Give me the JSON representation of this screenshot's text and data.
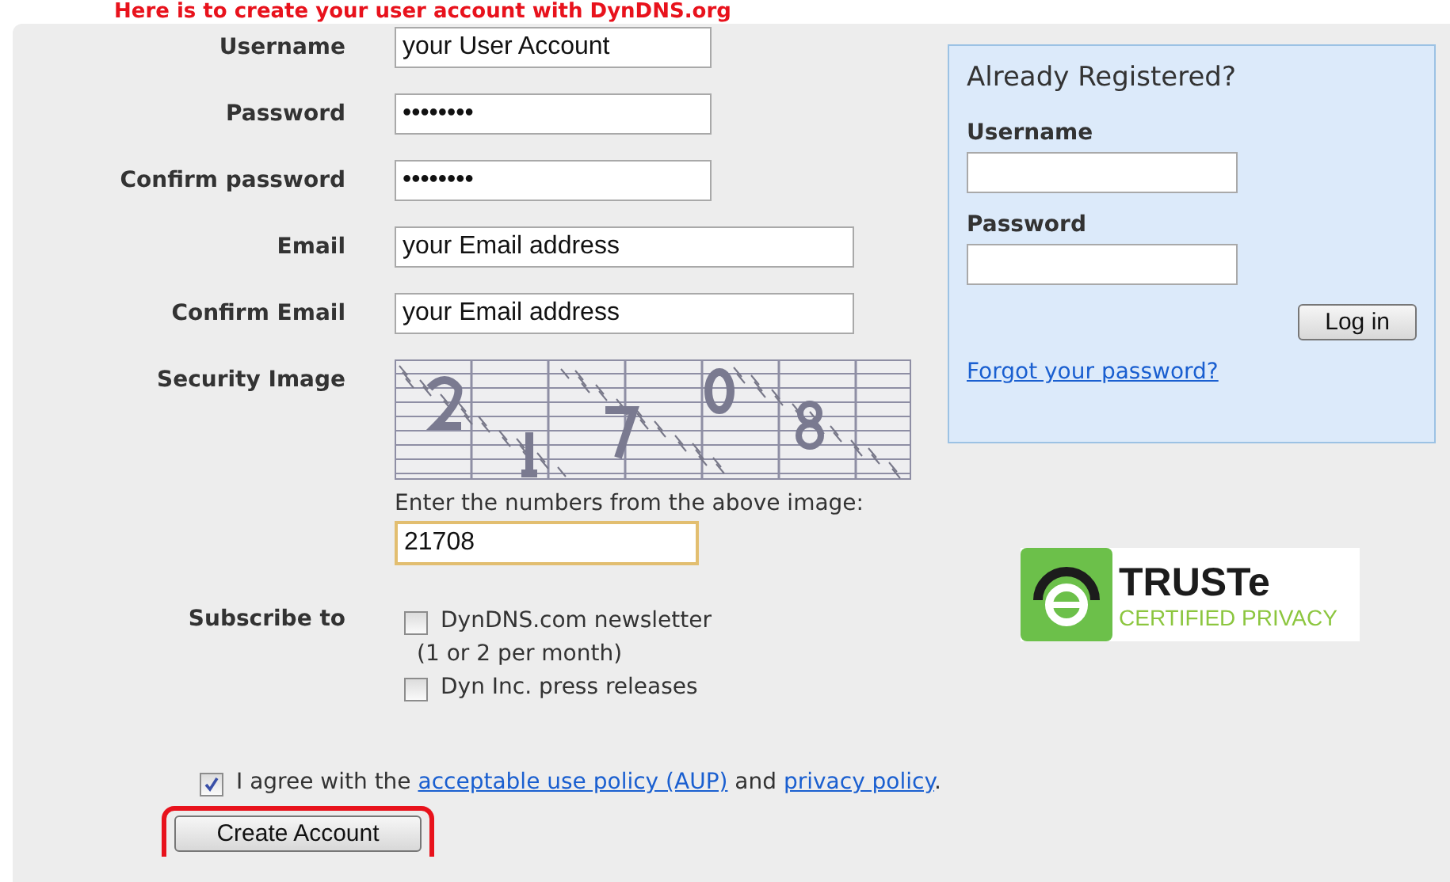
{
  "heading": "Here is to create your user account with DynDNS.org",
  "fields": [
    {
      "label": "Username",
      "value": "your User Account",
      "kind": "text"
    },
    {
      "label": "Password",
      "value": "••••••••",
      "kind": "password"
    },
    {
      "label": "Confirm password",
      "value": "••••••••",
      "kind": "password"
    },
    {
      "label": "Email",
      "value": "your Email address",
      "kind": "email"
    },
    {
      "label": "Confirm Email",
      "value": "your Email address",
      "kind": "email"
    }
  ],
  "security": {
    "label": "Security Image",
    "hint": "Enter the numbers from the above image:",
    "value": "21708",
    "focused": true
  },
  "subscribe": {
    "label": "Subscribe to",
    "options": [
      {
        "label": "DynDNS.com newsletter",
        "note": "(1 or 2 per month)",
        "checked": false
      },
      {
        "label": "Dyn Inc. press releases",
        "checked": false
      }
    ]
  },
  "agree": {
    "checked": true,
    "parts": [
      {
        "kind": "text",
        "text": "I agree with the "
      },
      {
        "kind": "link",
        "text": "acceptable use policy (AUP)"
      },
      {
        "kind": "text",
        "text": " and "
      },
      {
        "kind": "link",
        "text": "privacy policy"
      },
      {
        "kind": "text",
        "text": "."
      }
    ]
  },
  "create": {
    "label": "Create Account",
    "highlighted": true
  },
  "login": {
    "title": "Already Registered?",
    "fields": [
      {
        "label": "Username"
      },
      {
        "label": "Password"
      }
    ],
    "button": "Log in",
    "link": "Forgot your password?"
  },
  "badge": {
    "name": "TRUSTe",
    "tagline": "CERTIFIED PRIVACY"
  }
}
